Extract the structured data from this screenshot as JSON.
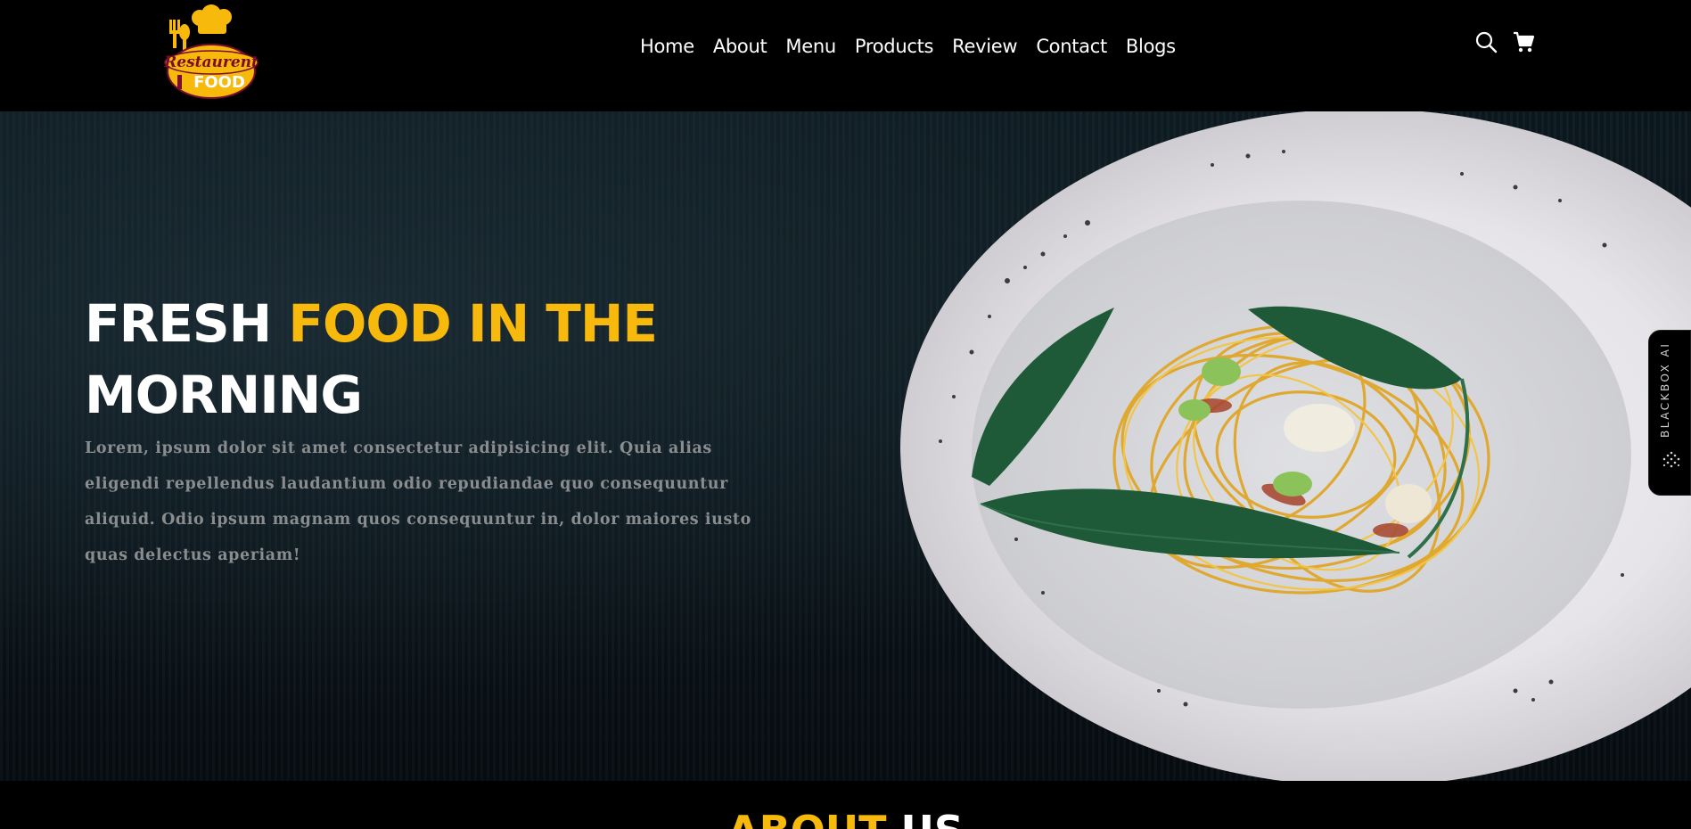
{
  "brand": {
    "logo_top": "Restaurent",
    "logo_bottom": "FOOD",
    "accent_color": "#f7b90c"
  },
  "nav": {
    "items": [
      {
        "label": "Home"
      },
      {
        "label": "About"
      },
      {
        "label": "Menu"
      },
      {
        "label": "Products"
      },
      {
        "label": "Review"
      },
      {
        "label": "Contact"
      },
      {
        "label": "Blogs"
      }
    ]
  },
  "header_icons": [
    "search-icon",
    "cart-icon"
  ],
  "hero": {
    "title_white_1": "FRESH ",
    "title_accent": "FOOD IN THE",
    "title_white_2": "MORNING",
    "text": "Lorem, ipsum dolor sit amet consectetur adipisicing elit. Quia alias eligendi repellendus laudantium odio repudiandae quo consequuntur aliquid. Odio ipsum magnam quos consequuntur in, dolor maiores iusto quas delectus aperiam!"
  },
  "side_tab": {
    "label": "BLACKBOX AI"
  },
  "about": {
    "title_accent": "ABOUT",
    "title_white": " US"
  }
}
